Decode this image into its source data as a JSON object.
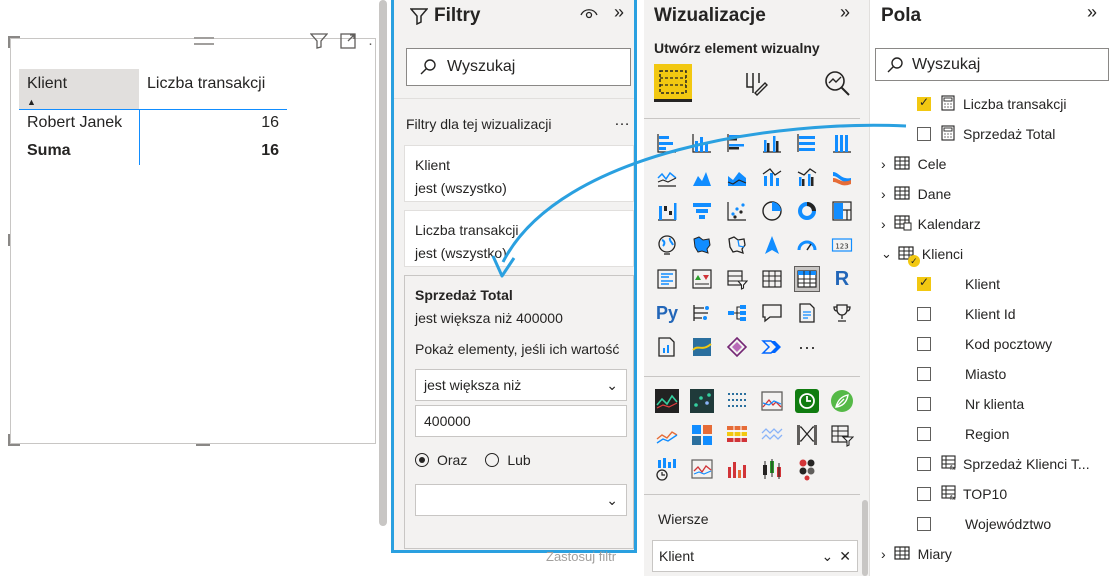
{
  "canvas": {
    "table": {
      "headers": [
        "Klient",
        "Liczba transakcji"
      ],
      "rows": [
        {
          "klient": "Robert Janek",
          "value": "16"
        }
      ],
      "total": {
        "label": "Suma",
        "value": "16"
      }
    }
  },
  "filters": {
    "title": "Filtry",
    "search_placeholder": "Wyszukaj",
    "section_label": "Filtry dla tej wizualizacji",
    "cards": [
      {
        "name": "Klient",
        "state": "jest (wszystko)"
      },
      {
        "name": "Liczba transakcji",
        "state": "jest (wszystko)"
      }
    ],
    "expanded": {
      "name": "Sprzedaż Total",
      "state": "jest większa niż 400000",
      "show_label": "Pokaż elementy, jeśli ich wartość",
      "operator": "jest większa niż",
      "value": "400000",
      "and_label": "Oraz",
      "or_label": "Lub",
      "second_operator": ""
    },
    "apply_label": "Zastosuj filtr"
  },
  "visualizations": {
    "title": "Wizualizacje",
    "subtitle": "Utwórz element wizualny",
    "rows_label": "Wiersze",
    "rows_field": "Klient",
    "more_label": "···"
  },
  "fields": {
    "title": "Pola",
    "search_placeholder": "Wyszukaj",
    "items": [
      {
        "label": "Liczba transakcji",
        "kind": "measure",
        "checked": true
      },
      {
        "label": "Sprzedaż Total",
        "kind": "measure",
        "checked": false
      },
      {
        "label": "Cele",
        "kind": "table"
      },
      {
        "label": "Dane",
        "kind": "table"
      },
      {
        "label": "Kalendarz",
        "kind": "table"
      },
      {
        "label": "Klienci",
        "kind": "table-open"
      },
      {
        "label": "Klient",
        "kind": "field",
        "checked": true
      },
      {
        "label": "Klient Id",
        "kind": "field",
        "checked": false
      },
      {
        "label": "Kod pocztowy",
        "kind": "field",
        "checked": false
      },
      {
        "label": "Miasto",
        "kind": "field",
        "checked": false
      },
      {
        "label": "Nr klienta",
        "kind": "field",
        "checked": false
      },
      {
        "label": "Region",
        "kind": "field",
        "checked": false
      },
      {
        "label": "Sprzedaż Klienci T...",
        "kind": "measure",
        "checked": false
      },
      {
        "label": "TOP10",
        "kind": "measure",
        "checked": false
      },
      {
        "label": "Województwo",
        "kind": "field",
        "checked": false
      },
      {
        "label": "Miary",
        "kind": "table"
      }
    ]
  },
  "colors": {
    "accent": "#2aa0e0",
    "highlight": "#f2c811",
    "pane": "#f3f2f1"
  }
}
